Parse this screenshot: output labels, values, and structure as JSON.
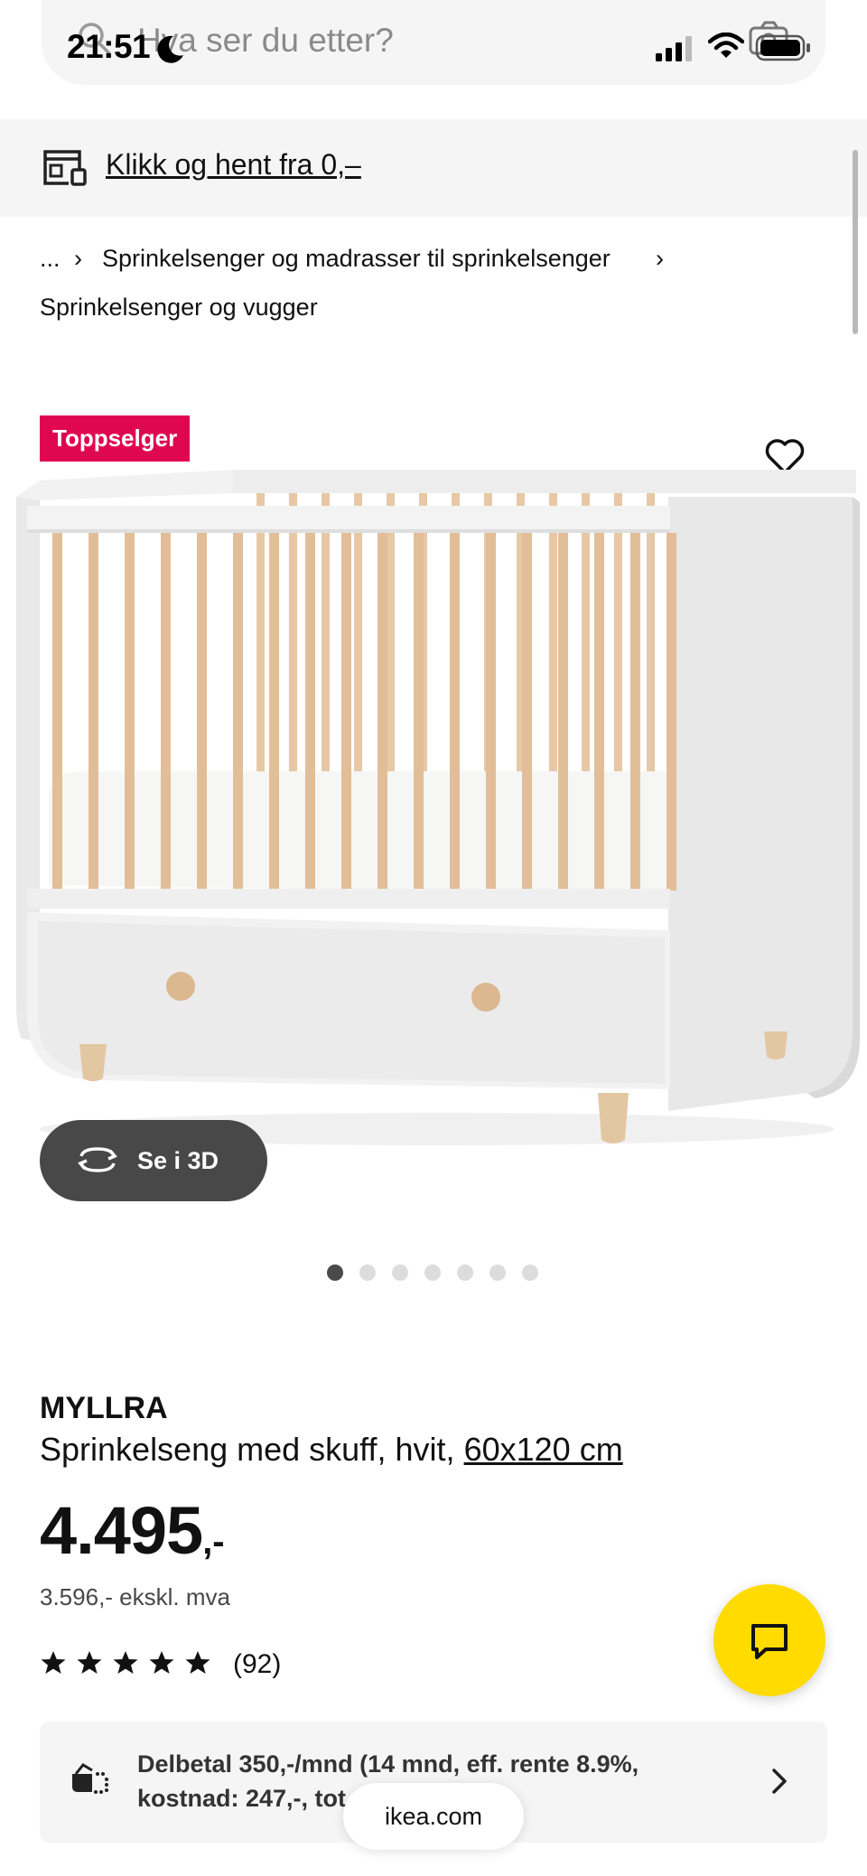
{
  "status_bar": {
    "time": "21:51",
    "icons": [
      "moon-icon",
      "signal-icon",
      "wifi-icon",
      "battery-icon"
    ]
  },
  "search": {
    "placeholder": "Hva ser du etter?",
    "icons": [
      "search-icon",
      "camera-icon"
    ]
  },
  "click_collect": {
    "label": "Klikk og hent fra 0,–",
    "icon": "store-icon"
  },
  "breadcrumb": {
    "ellipsis": "...",
    "separator": "›",
    "level2": "Sprinkelsenger og madrasser til sprinkelsenger",
    "level3": "Sprinkelsenger og vugger"
  },
  "product_image": {
    "badge": "Toppselger",
    "favorite_icon": "heart-icon",
    "see_3d_label": "Se i 3D",
    "carousel_count": 7,
    "carousel_active": 1
  },
  "product": {
    "brand": "MYLLRA",
    "description": "Sprinkelseng med skuff, hvit,",
    "size": "60x120 cm",
    "price": "4.495",
    "price_suffix": ",-",
    "price_ex_vat": "3.596,- ekskl. mva",
    "rating": 5,
    "rating_count": "(92)"
  },
  "financing": {
    "line1": "Delbetal 350,-/mnd (14 mnd, eff. rente 8.9%,",
    "line2": "kostnad: 247,-, tot"
  },
  "browser": {
    "url": "ikea.com"
  },
  "colors": {
    "badge": "#e00751",
    "chat_button": "#ffdb00",
    "see3d_button": "#484848",
    "panel_bg": "#f5f5f5"
  }
}
